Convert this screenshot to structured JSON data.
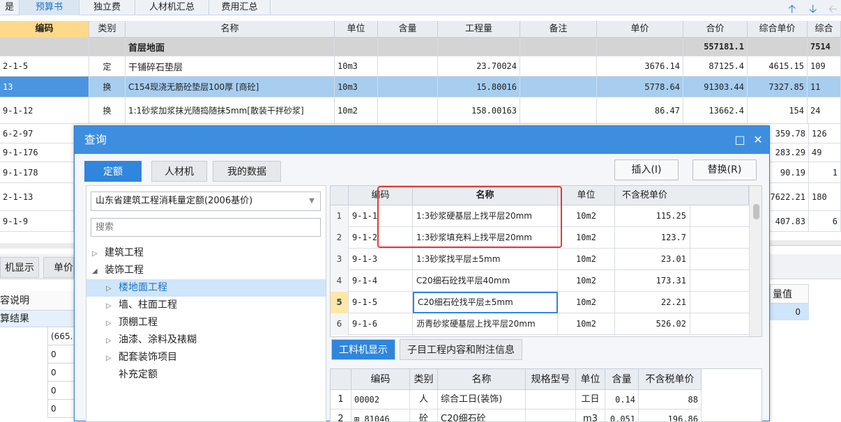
{
  "top_tabs": [
    {
      "label": "是"
    },
    {
      "label": "预算书"
    },
    {
      "label": "独立费"
    },
    {
      "label": "人材机汇总"
    },
    {
      "label": "费用汇总"
    }
  ],
  "top_arrows": {
    "up": "up-arrow-icon",
    "down": "down-arrow-icon",
    "left": "left-arrow-icon"
  },
  "main_grid": {
    "headers": [
      "编码",
      "类别",
      "名称",
      "单位",
      "含量",
      "工程量",
      "备注",
      "单价",
      "合价",
      "综合单价",
      "综合"
    ],
    "rows": [
      {
        "code": "",
        "type": "",
        "name": "首层地面",
        "unit": "",
        "content": "",
        "qty": "",
        "note": "",
        "price": "",
        "total": "557181.1",
        "unit_total": "",
        "extra": "7514"
      },
      {
        "code": "2-1-5",
        "type": "定",
        "name": "干铺碎石垫层",
        "unit": "10m3",
        "content": "",
        "qty": "23.70024",
        "note": "",
        "price": "3676.14",
        "total": "87125.4",
        "unit_total": "4615.15",
        "extra": "109"
      },
      {
        "code": "13",
        "type": "换",
        "name": "C154现浇无筋砼垫层100厚 [商砼]",
        "unit": "10m3",
        "content": "",
        "qty": "15.80016",
        "note": "",
        "price": "5778.64",
        "total": "91303.44",
        "unit_total": "7327.85",
        "extra": "11"
      },
      {
        "code": "9-1-12",
        "type": "换",
        "name": "1:1砂浆加浆抹光随捣随抹5mm[散装干拌砂浆]",
        "unit": "10m2",
        "content": "",
        "qty": "158.00163",
        "note": "",
        "price": "86.47",
        "total": "13662.4",
        "unit_total": "154",
        "extra": "24"
      },
      {
        "code": "6-2-97",
        "unit_total": "359.78",
        "extra": "126"
      },
      {
        "code": "9-1-176",
        "unit_total": "283.29",
        "extra": "49"
      },
      {
        "code": "9-1-178",
        "unit_total": "90.19",
        "extra": "1"
      },
      {
        "code": "2-1-13",
        "unit_total": "7622.21",
        "extra": "180"
      },
      {
        "code": "9-1-9",
        "unit_total": "407.83",
        "extra": "6"
      }
    ]
  },
  "lower_left": {
    "tabs": [
      "机显示",
      "单价"
    ],
    "rows": [
      "容说明",
      "算结果"
    ],
    "values": [
      "(665.",
      "0",
      "0",
      "0",
      "0"
    ]
  },
  "right_strip": {
    "label": "量值",
    "value": "0"
  },
  "dialog": {
    "title": "查询",
    "maximize_icon": "maximize-icon",
    "close_icon": "close-icon",
    "tabs": [
      "定额",
      "人材机",
      "我的数据"
    ],
    "insert_label": "插入(I)",
    "replace_label": "替换(R)",
    "combo_value": "山东省建筑工程消耗量定额(2006基价)",
    "search_placeholder": "搜索",
    "tree": [
      {
        "label": "建筑工程",
        "level": 0,
        "expand": "collapsed"
      },
      {
        "label": "装饰工程",
        "level": 0,
        "expand": "expanded"
      },
      {
        "label": "楼地面工程",
        "level": 1,
        "expand": "collapsed",
        "selected": true
      },
      {
        "label": "墙、柱面工程",
        "level": 1,
        "expand": "collapsed"
      },
      {
        "label": "顶棚工程",
        "level": 1,
        "expand": "collapsed"
      },
      {
        "label": "油漆、涂料及裱糊",
        "level": 1,
        "expand": "collapsed"
      },
      {
        "label": "配套装饰项目",
        "level": 1,
        "expand": "collapsed"
      },
      {
        "label": "补充定额",
        "level": 1,
        "expand": "none"
      }
    ],
    "query_grid": {
      "headers": [
        "编码",
        "名称",
        "单位",
        "不含税单价"
      ],
      "rows": [
        {
          "num": "1",
          "code": "9-1-1",
          "name": "1:3砂浆硬基层上找平层20mm",
          "unit": "10m2",
          "price": "115.25"
        },
        {
          "num": "2",
          "code": "9-1-2",
          "name": "1:3砂浆填充料上找平层20mm",
          "unit": "10m2",
          "price": "123.7"
        },
        {
          "num": "3",
          "code": "9-1-3",
          "name": "1:3砂浆找平层±5mm",
          "unit": "10m2",
          "price": "23.01"
        },
        {
          "num": "4",
          "code": "9-1-4",
          "name": "C20细石砼找平层40mm",
          "unit": "10m2",
          "price": "173.31"
        },
        {
          "num": "5",
          "code": "9-1-5",
          "name": "C20细石砼找平层±5mm",
          "unit": "10m2",
          "price": "22.21"
        },
        {
          "num": "6",
          "code": "9-1-6",
          "name": "沥青砂浆硬基层上找平层20mm",
          "unit": "10m2",
          "price": "526.02"
        }
      ]
    },
    "bottom_tabs": [
      "工料机显示",
      "子目工程内容和附注信息"
    ],
    "bottom_grid": {
      "headers": [
        "编码",
        "类别",
        "名称",
        "规格型号",
        "单位",
        "含量",
        "不含税单价"
      ],
      "rows": [
        {
          "num": "1",
          "code": "00002",
          "type": "人",
          "name": "综合工日(装饰)",
          "spec": "",
          "unit": "工日",
          "content": "0.14",
          "price": "88"
        },
        {
          "num": "2",
          "code": "81046",
          "type": "砼",
          "name": "C20细石砼",
          "spec": "",
          "unit": "m3",
          "content": "0.051",
          "price": "196.86"
        }
      ]
    }
  }
}
